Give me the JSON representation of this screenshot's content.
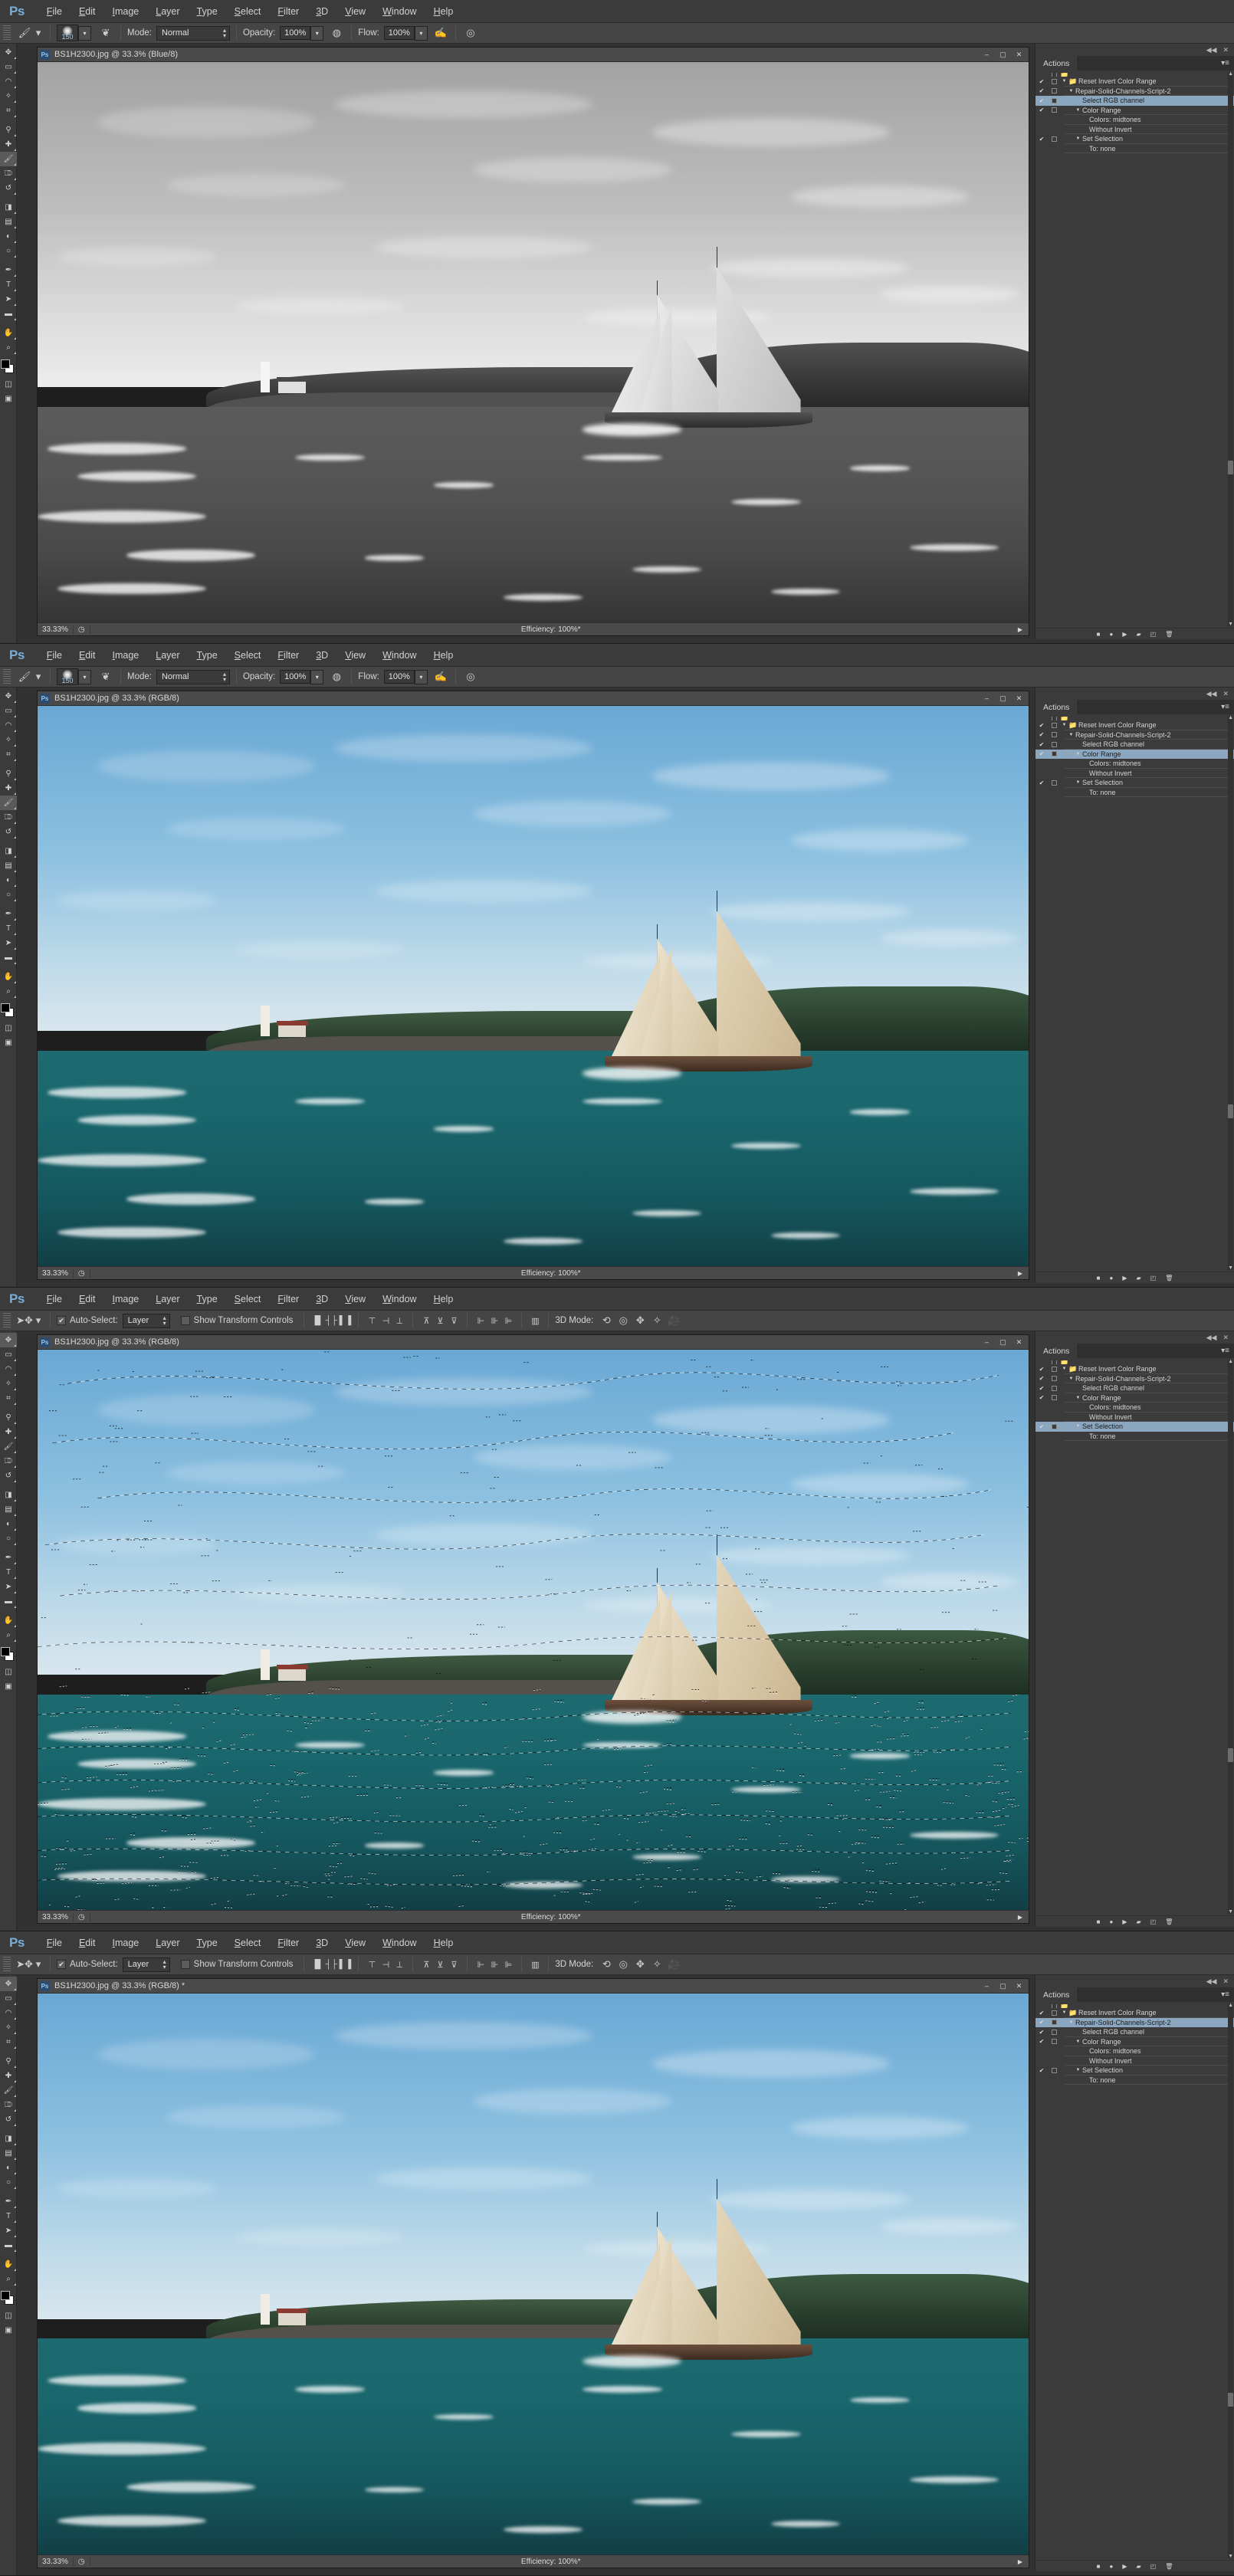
{
  "app": {
    "name": "Adobe Photoshop",
    "logo": "Ps",
    "menus": [
      "File",
      "Edit",
      "Image",
      "Layer",
      "Type",
      "Select",
      "Filter",
      "3D",
      "View",
      "Window",
      "Help"
    ]
  },
  "colors": {
    "accent_blue": "#7aaed6",
    "panel_bg": "#3b3b3b",
    "menubar_bg": "#3b3b3b",
    "optionsbar_bg": "#454545",
    "highlight_row": "#8aa7bf",
    "canvas_sky": "#7fb4d8",
    "canvas_sea": "#1f6a6e",
    "sail_tan": "#d8c6a6",
    "title_bar": "#4a4a4a"
  },
  "options_bar_brush": {
    "tool_icon": "brush-tool-icon",
    "brush_size": "150",
    "mode_label": "Mode:",
    "mode_value": "Normal",
    "opacity_label": "Opacity:",
    "opacity_value": "100%",
    "flow_label": "Flow:",
    "flow_value": "100%",
    "airbrush_icon": "airbrush-icon",
    "pressure_opacity_icon": "pressure-opacity-icon",
    "pressure_size_icon": "pressure-size-icon"
  },
  "options_bar_move": {
    "tool_icon": "move-tool-icon",
    "auto_select_label": "Auto-Select:",
    "auto_select_checked": true,
    "auto_select_value": "Layer",
    "show_transform_label": "Show Transform Controls",
    "show_transform_checked": false,
    "mode_3d_label": "3D Mode:",
    "align_icons": [
      "align-left-edges-icon",
      "align-horizontal-centers-icon",
      "align-right-edges-icon",
      "align-top-edges-icon",
      "align-vertical-centers-icon",
      "align-bottom-edges-icon",
      "distribute-top-icon",
      "distribute-vertical-center-icon",
      "distribute-bottom-icon",
      "distribute-left-icon",
      "distribute-horizontal-center-icon",
      "distribute-right-icon",
      "auto-align-layers-icon"
    ],
    "mode_3d_icons": [
      "rotate-3d-icon",
      "roll-3d-icon",
      "pan-3d-icon",
      "slide-3d-icon",
      "scale-3d-icon"
    ]
  },
  "tools": [
    {
      "name": "move-tool",
      "glyph": "✥"
    },
    {
      "name": "rectangular-marquee-tool",
      "glyph": "▭"
    },
    {
      "name": "lasso-tool",
      "glyph": "◠"
    },
    {
      "name": "quick-selection-tool",
      "glyph": "✧"
    },
    {
      "name": "crop-tool",
      "glyph": "⌗"
    },
    {
      "name": "eyedropper-tool",
      "glyph": "⚲"
    },
    {
      "name": "spot-healing-brush-tool",
      "glyph": "✚"
    },
    {
      "name": "brush-tool",
      "glyph": "🖌"
    },
    {
      "name": "clone-stamp-tool",
      "glyph": "⎄"
    },
    {
      "name": "history-brush-tool",
      "glyph": "↺"
    },
    {
      "name": "eraser-tool",
      "glyph": "◨"
    },
    {
      "name": "gradient-tool",
      "glyph": "▤"
    },
    {
      "name": "blur-tool",
      "glyph": "◐"
    },
    {
      "name": "dodge-tool",
      "glyph": "○"
    },
    {
      "name": "pen-tool",
      "glyph": "✒"
    },
    {
      "name": "horizontal-type-tool",
      "glyph": "T"
    },
    {
      "name": "path-selection-tool",
      "glyph": "➤"
    },
    {
      "name": "rectangle-tool",
      "glyph": "▬"
    },
    {
      "name": "hand-tool",
      "glyph": "✋"
    },
    {
      "name": "zoom-tool",
      "glyph": "⌕"
    }
  ],
  "tools_bottom": [
    {
      "name": "edit-in-quick-mask-mode",
      "glyph": "◫"
    },
    {
      "name": "change-screen-mode",
      "glyph": "▣"
    }
  ],
  "actions_panel": {
    "tab_label": "Actions",
    "menu_icon": "panel-menu-icon",
    "collapse_icon": "collapse-to-icons-icon",
    "close_icon": "close-panel-icon",
    "footer_buttons": [
      {
        "name": "stop-playing-recording-button",
        "glyph": "■"
      },
      {
        "name": "begin-recording-button",
        "glyph": "●"
      },
      {
        "name": "play-selection-button",
        "glyph": "▶"
      },
      {
        "name": "create-new-set-button",
        "glyph": "▰"
      },
      {
        "name": "create-new-action-button",
        "glyph": "◰"
      },
      {
        "name": "delete-button",
        "glyph": "🗑"
      }
    ],
    "rows": [
      {
        "label": "Reset Invert Color Range",
        "check": true,
        "box": true,
        "tri": true,
        "folder": true,
        "indent": 0
      },
      {
        "label": "Repair-Solid-Channels-Script-2",
        "check": true,
        "box": true,
        "tri": true,
        "folder": false,
        "indent": 1
      },
      {
        "label": "Select RGB channel",
        "check": true,
        "box": true,
        "tri": false,
        "folder": false,
        "indent": 2
      },
      {
        "label": "Color Range",
        "check": true,
        "box": true,
        "tri": true,
        "folder": false,
        "indent": 2
      },
      {
        "label": "Colors: midtones",
        "check": false,
        "box": false,
        "tri": false,
        "folder": false,
        "indent": 3
      },
      {
        "label": "Without Invert",
        "check": false,
        "box": false,
        "tri": false,
        "folder": false,
        "indent": 3
      },
      {
        "label": "Set Selection",
        "check": true,
        "box": true,
        "tri": true,
        "folder": false,
        "indent": 2
      },
      {
        "label": "To: none",
        "check": false,
        "box": false,
        "tri": false,
        "folder": false,
        "indent": 3
      }
    ]
  },
  "windows": [
    {
      "id": "win1",
      "doc_title": "BS1H2300.jpg @ 33.3% (Blue/8)",
      "doc_icon": "Ps",
      "zoom": "33.33%",
      "efficiency": "Efficiency: 100%*",
      "active_tool": "brush-tool",
      "options_bar": "brush",
      "render": "grayscale",
      "selection_marching_ants": false,
      "highlighted_action": "Select RGB channel",
      "window_buttons": [
        {
          "name": "minimize-button",
          "glyph": "–"
        },
        {
          "name": "maximize-button",
          "glyph": "▢"
        },
        {
          "name": "close-button",
          "glyph": "✕"
        }
      ]
    },
    {
      "id": "win2",
      "doc_title": "BS1H2300.jpg @ 33.3% (RGB/8)",
      "doc_icon": "Ps",
      "zoom": "33.33%",
      "efficiency": "Efficiency: 100%*",
      "active_tool": "brush-tool",
      "options_bar": "brush",
      "render": "color",
      "selection_marching_ants": false,
      "highlighted_action": "Color Range",
      "window_buttons": [
        {
          "name": "minimize-button",
          "glyph": "–"
        },
        {
          "name": "maximize-button",
          "glyph": "▢"
        },
        {
          "name": "close-button",
          "glyph": "✕"
        }
      ]
    },
    {
      "id": "win3",
      "doc_title": "BS1H2300.jpg @ 33.3% (RGB/8)",
      "doc_icon": "Ps",
      "zoom": "33.33%",
      "efficiency": "Efficiency: 100%*",
      "active_tool": "move-tool",
      "options_bar": "move",
      "render": "color",
      "selection_marching_ants": true,
      "highlighted_action": "Set Selection",
      "window_buttons": [
        {
          "name": "minimize-button",
          "glyph": "–"
        },
        {
          "name": "maximize-button",
          "glyph": "▢"
        },
        {
          "name": "close-button",
          "glyph": "✕"
        }
      ]
    },
    {
      "id": "win4",
      "doc_title": "BS1H2300.jpg @ 33.3% (RGB/8) *",
      "doc_icon": "Ps",
      "zoom": "33.33%",
      "efficiency": "Efficiency: 100%*",
      "active_tool": "move-tool",
      "options_bar": "move",
      "render": "color",
      "selection_marching_ants": false,
      "highlighted_action": "Repair-Solid-Channels-Script-2",
      "window_buttons": [
        {
          "name": "minimize-button",
          "glyph": "–"
        },
        {
          "name": "maximize-button",
          "glyph": "▢"
        },
        {
          "name": "close-button",
          "glyph": "✕"
        }
      ]
    }
  ]
}
